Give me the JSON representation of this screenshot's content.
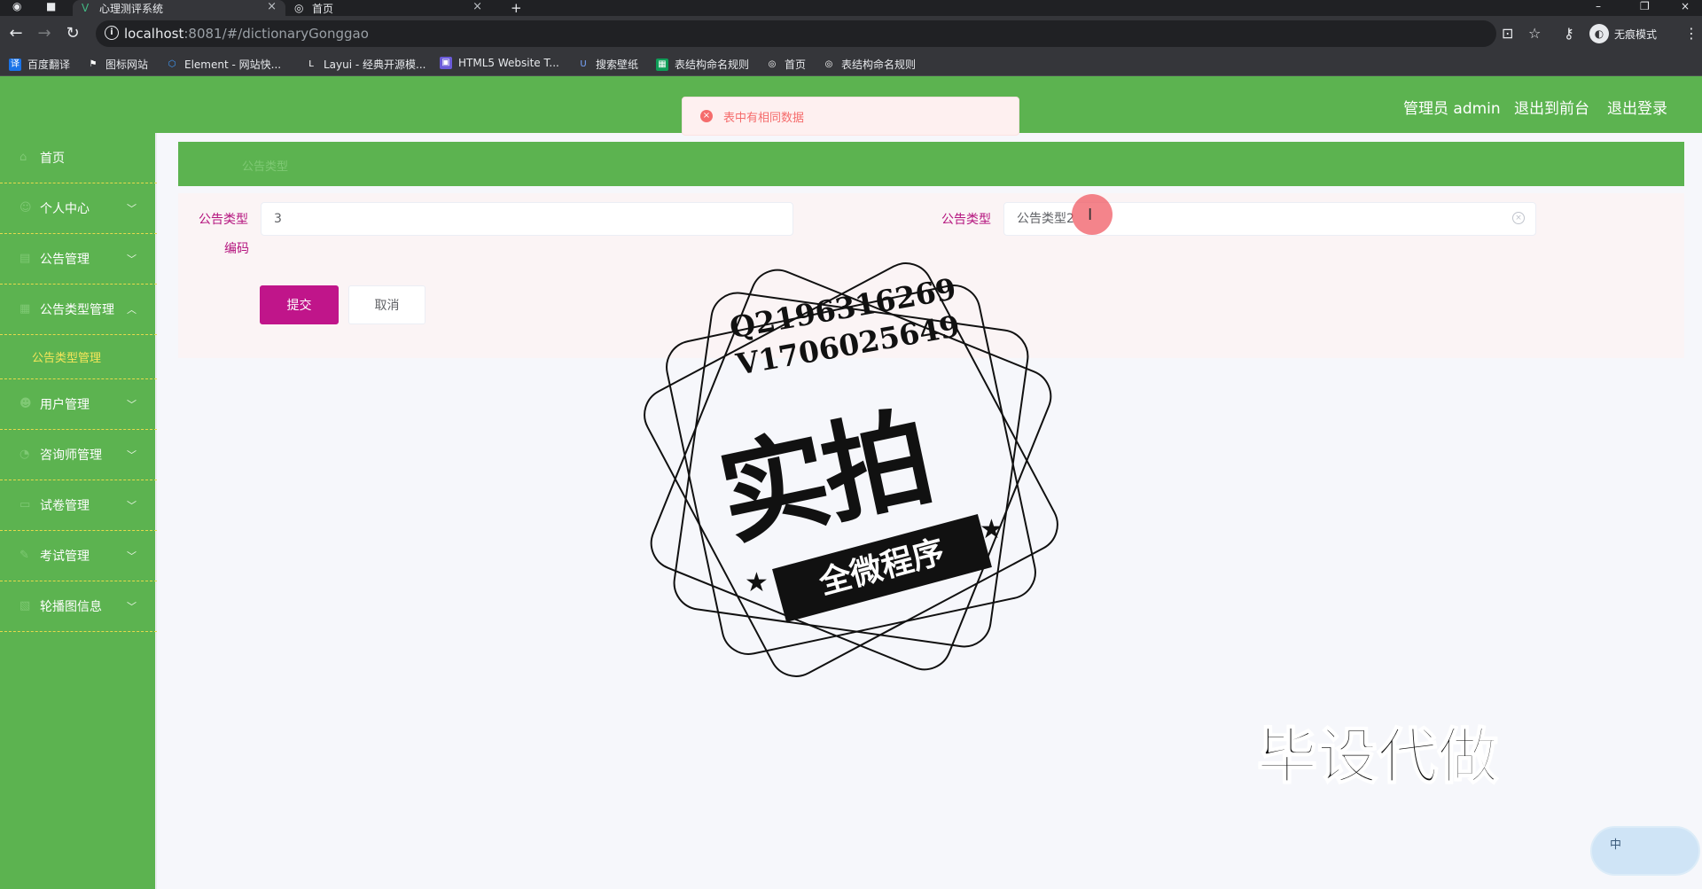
{
  "browser": {
    "tabs": [
      {
        "title": "心理测评系统",
        "active": true
      },
      {
        "title": "首页",
        "active": false
      }
    ],
    "url_host": "localhost",
    "url_path": ":8081/#/dictionaryGonggao",
    "incognito_label": "无痕模式",
    "bookmarks": [
      {
        "label": "百度翻译",
        "icon": "translate-icon"
      },
      {
        "label": "图标网站",
        "icon": "flag-icon"
      },
      {
        "label": "Element - 网站快...",
        "icon": "element-icon"
      },
      {
        "label": "Layui - 经典开源模...",
        "icon": "layui-icon"
      },
      {
        "label": "HTML5 Website T...",
        "icon": "html5-icon"
      },
      {
        "label": "搜索壁纸",
        "icon": "wallpaper-icon"
      },
      {
        "label": "表结构命名规则",
        "icon": "sheet-icon"
      },
      {
        "label": "首页",
        "icon": "globe-icon"
      },
      {
        "label": "表结构命名规则",
        "icon": "globe-icon"
      }
    ]
  },
  "header": {
    "admin_label": "管理员 admin",
    "front_label": "退出到前台",
    "logout_label": "退出登录"
  },
  "toast": {
    "message": "表中有相同数据",
    "color": "#f56c6c"
  },
  "sidebar": {
    "items": [
      {
        "label": "首页",
        "has_children": false
      },
      {
        "label": "个人中心",
        "has_children": true
      },
      {
        "label": "公告管理",
        "has_children": true
      },
      {
        "label": "公告类型管理",
        "has_children": true,
        "expanded": true
      },
      {
        "label": "用户管理",
        "has_children": true
      },
      {
        "label": "咨询师管理",
        "has_children": true
      },
      {
        "label": "试卷管理",
        "has_children": true
      },
      {
        "label": "考试管理",
        "has_children": true
      },
      {
        "label": "轮播图信息",
        "has_children": true
      }
    ],
    "sub_item": "公告类型管理"
  },
  "main": {
    "breadcrumb": "公告类型",
    "form": {
      "field1_label": "公告类型",
      "field1_sublabel": "编码",
      "field1_value": "3",
      "field2_label": "公告类型",
      "field2_value": "公告类型2"
    },
    "submit_label": "提交",
    "cancel_label": "取消"
  },
  "watermark": {
    "contact_line1": "Q2196316269",
    "contact_line2": "V1706025649",
    "big_text": "实拍",
    "ribbon_text": "全微程序",
    "side_text": "毕设代做",
    "corner_text": "中"
  },
  "colors": {
    "brand_green": "#5cb350",
    "primary_magenta": "#c0158a",
    "label_magenta": "#b4147e",
    "submenu_yellow": "#f5e65a"
  }
}
